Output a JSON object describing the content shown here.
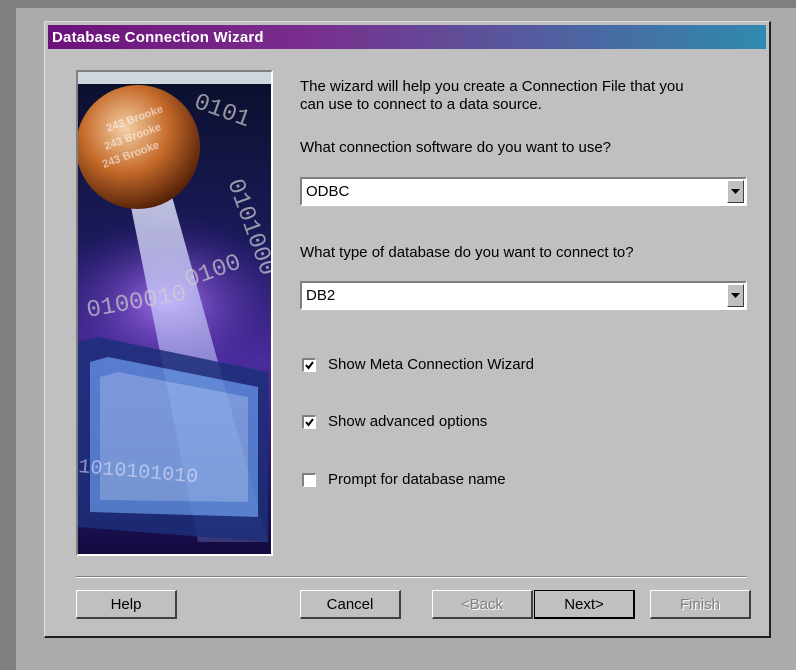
{
  "window": {
    "title": "Database Connection Wizard"
  },
  "illustration": {
    "name": "wizard-banner-image"
  },
  "intro_text": {
    "line1": "The wizard will help you create a Connection File that you",
    "line2": "can use to connect to a data source."
  },
  "software": {
    "question": "What connection software do you want to use?",
    "selected": "ODBC"
  },
  "database": {
    "question": "What type of database do you want to connect to?",
    "selected": "DB2"
  },
  "options": [
    {
      "label": "Show Meta Connection Wizard",
      "checked": true
    },
    {
      "label": "Show advanced options",
      "checked": true
    },
    {
      "label": "Prompt for database name",
      "checked": false
    }
  ],
  "buttons": {
    "help": "Help",
    "cancel": "Cancel",
    "back": "<Back",
    "next": "Next>",
    "finish": "Finish"
  },
  "colors": {
    "dialog_face": "#c0c0c0",
    "titlebar_start": "#6b127a",
    "titlebar_end": "#2f8ab0"
  }
}
